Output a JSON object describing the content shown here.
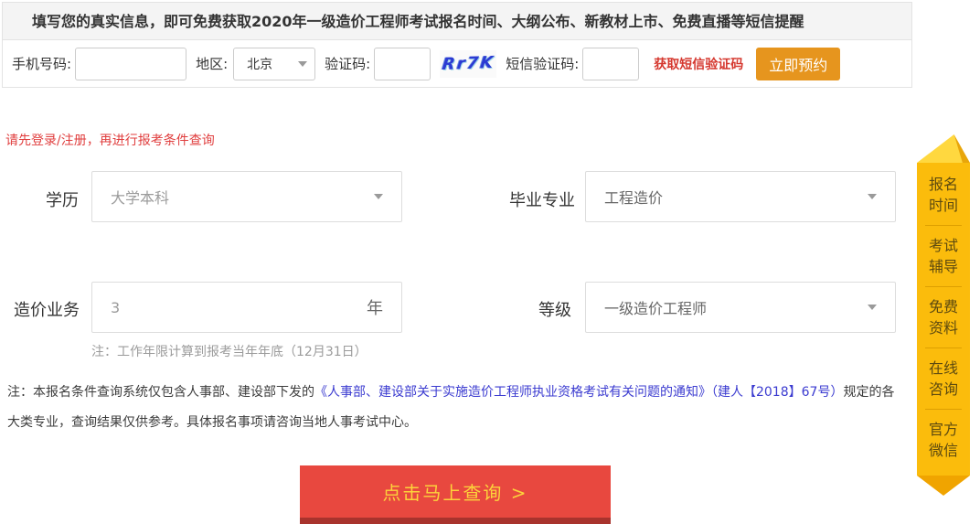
{
  "banner": {
    "text": "填写您的真实信息，即可免费获取2020年一级造价工程师考试报名时间、大纲公布、新教材上市、免费直播等短信提醒"
  },
  "reserve_form": {
    "phone_label": "手机号码:",
    "region_label": "地区:",
    "region_value": "北京",
    "captcha_label": "验证码:",
    "captcha_text": "Rr7K",
    "sms_label": "短信验证码:",
    "get_sms_label": "获取短信验证码",
    "reserve_button": "立即预约"
  },
  "login_notice": "请先登录/注册，再进行报考条件查询",
  "query_form": {
    "education_label": "学历",
    "education_value": "大学本科",
    "major_label": "毕业专业",
    "major_value": "工程造价",
    "experience_label": "造价业务",
    "experience_value": "3",
    "experience_unit": "年",
    "experience_note": "注：工作年限计算到报考当年年底（12月31日）",
    "level_label": "等级",
    "level_value": "一级造价工程师"
  },
  "disclaimer": {
    "prefix": "注：本报名条件查询系统仅包含人事部、建设部下发的",
    "link": "《人事部、建设部关于实施造价工程师执业资格考试有关问题的通知》（建人【2018】67号）",
    "suffix": "规定的各大类专业，查询结果仅供参考。具体报名事项请咨询当地人事考试中心。"
  },
  "query_button": "点击马上查询 >",
  "sidebar": {
    "items": [
      "报名时间",
      "考试辅导",
      "免费资料",
      "在线咨询",
      "官方微信"
    ]
  },
  "colors": {
    "accent_orange": "#e6951e",
    "ribbon_yellow": "#fbbc0c",
    "query_button_red": "#e8483f",
    "query_button_text": "#fcd33b",
    "link_blue": "#3b3bd0",
    "notice_red": "#e03e3e"
  }
}
